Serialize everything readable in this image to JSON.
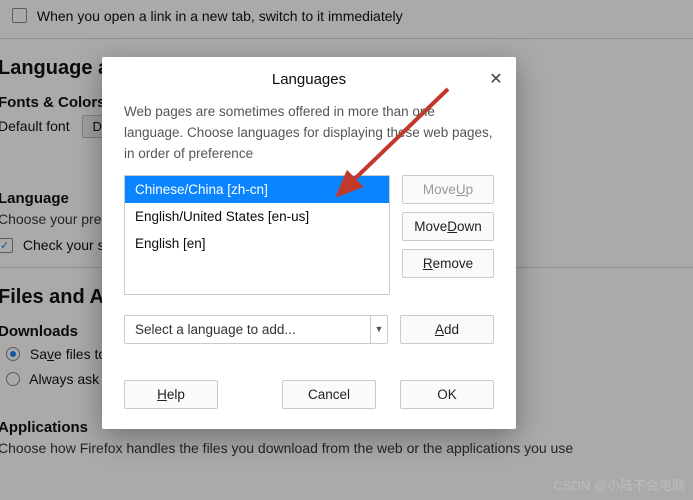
{
  "bg": {
    "tabs_switch": "When you open a link in a new tab, switch to it immediately",
    "section_lang_appearance": "Language and Appearance",
    "fonts_colors": "Fonts & Colors",
    "default_font_label": "Default font",
    "default_font_value": "Defa",
    "language_heading": "Language",
    "choose_pref": "Choose your preferr",
    "check_spell": "Check your spell",
    "files_apps": "Files and Appli",
    "downloads": "Downloads",
    "save_files": "Save files to",
    "always_ask": "Always ask you t",
    "applications": "Applications",
    "choose_apps": "Choose how Firefox handles the files you download from the web or the applications you use"
  },
  "dialog": {
    "title": "Languages",
    "description": "Web pages are sometimes offered in more than one language. Choose languages for displaying these web pages, in order of preference",
    "languages": [
      {
        "label": "Chinese/China  [zh-cn]",
        "selected": true
      },
      {
        "label": "English/United States  [en-us]",
        "selected": false
      },
      {
        "label": "English  [en]",
        "selected": false
      }
    ],
    "move_up": "Move Up",
    "move_down": "Move Down",
    "remove": "Remove",
    "select_lang": "Select a language to add...",
    "add": "Add",
    "help": "Help",
    "cancel": "Cancel",
    "ok": "OK"
  },
  "watermark": "CSDN @小陆不会电脑"
}
